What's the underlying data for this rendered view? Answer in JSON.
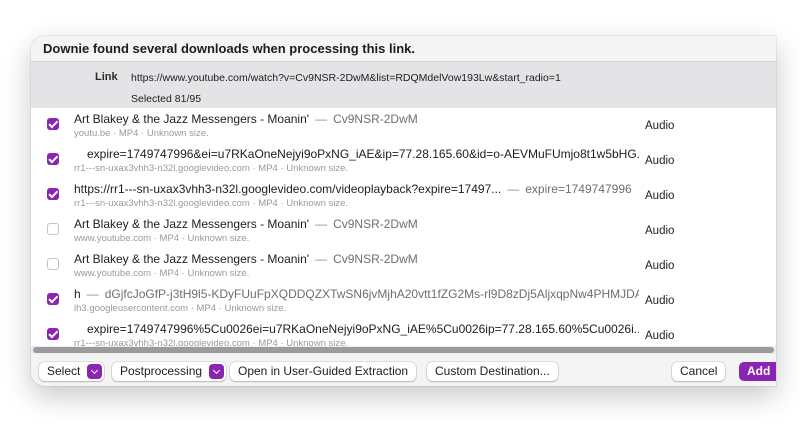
{
  "dialog": {
    "title": "Downie found several downloads when processing this link.",
    "link_label": "Link",
    "link_url": "https://www.youtube.com/watch?v=Cv9NSR-2DwM&list=RDQMdelVow193Lw&start_radio=1",
    "selected": "Selected 81/95"
  },
  "colors": {
    "accent": "#8a25b1"
  },
  "rows": [
    {
      "checked": true,
      "title": "Art Blakey & the Jazz Messengers - Moanin'",
      "sep": "—",
      "code": "Cv9NSR-2DwM",
      "sub": "youtu.be · MP4 · Unknown size.",
      "type": "Audio"
    },
    {
      "checked": true,
      "title": "expire=1749747996&ei=u7RKaOneNejyi9oPxNG_iAE&ip=77.28.165.60&id=o-AEVMuFUmjo8t1w5bHG...",
      "sep": "",
      "code": "",
      "sub": "rr1---sn-uxax3vhh3-n32l.googlevideo.com · MP4 · Unknown size.",
      "type": "Audio"
    },
    {
      "checked": true,
      "title": "https://rr1---sn-uxax3vhh3-n32l.googlevideo.com/videoplayback?expire=17497...",
      "sep": "—",
      "code": "expire=1749747996",
      "sub": "rr1---sn-uxax3vhh3-n32l.googlevideo.com · MP4 · Unknown size.",
      "type": "Audio"
    },
    {
      "checked": false,
      "title": "Art Blakey & the Jazz Messengers - Moanin'",
      "sep": "—",
      "code": "Cv9NSR-2DwM",
      "sub": "www.youtube.com · MP4 · Unknown size.",
      "type": "Audio"
    },
    {
      "checked": false,
      "title": "Art Blakey & the Jazz Messengers - Moanin'",
      "sep": "—",
      "code": "Cv9NSR-2DwM",
      "sub": "www.youtube.com · MP4 · Unknown size.",
      "type": "Audio"
    },
    {
      "checked": true,
      "title": "h",
      "sep": "—",
      "code": "dGjfcJoGfP-j3tH9l5-KDyFUuFpXQDDQZXTwSN6jvMjhA20vtt1fZG2Ms-rl9D8zDj5AljxqpNw4PHMJDA",
      "sub": "lh3.googleusercontent.com · MP4 · Unknown size.",
      "type": "Audio"
    },
    {
      "checked": true,
      "title": "expire=1749747996%5Cu0026ei=u7RKaOneNejyi9oPxNG_iAE%5Cu0026ip=77.28.165.60%5Cu0026i...",
      "sep": "",
      "code": "",
      "sub": "rr1---sn-uxax3vhh3-n32l.googlevideo.com · MP4 · Unknown size.",
      "type": "Audio"
    }
  ],
  "footer": {
    "select_label": "Select",
    "postprocessing_label": "Postprocessing",
    "open_guided_label": "Open in User-Guided Extraction",
    "custom_destination_label": "Custom Destination...",
    "cancel_label": "Cancel",
    "add_label": "Add"
  }
}
